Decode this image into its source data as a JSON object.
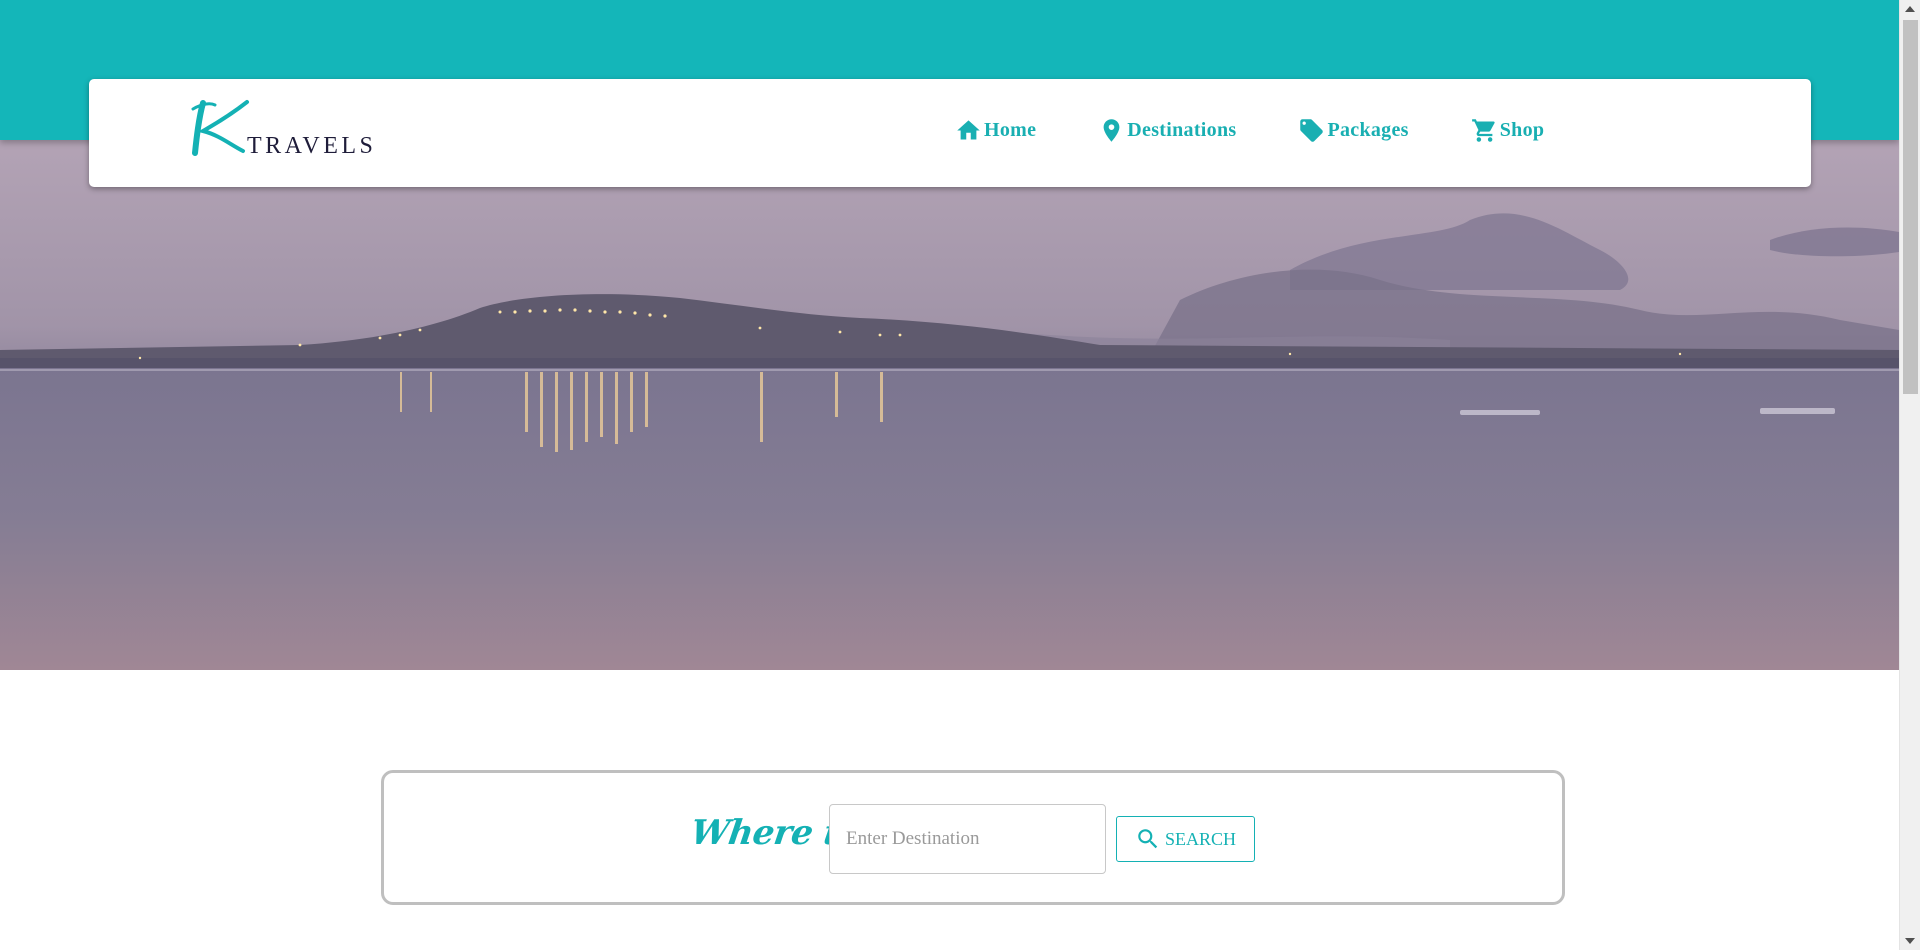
{
  "brand": {
    "mark": "K",
    "name": "TRAVELS"
  },
  "nav": {
    "items": [
      {
        "label": "Home",
        "icon": "home-icon"
      },
      {
        "label": "Destinations",
        "icon": "map-pin-icon"
      },
      {
        "label": "Packages",
        "icon": "tag-icon"
      },
      {
        "label": "Shop",
        "icon": "cart-icon"
      }
    ]
  },
  "hero": {
    "image": "lake-at-dusk-with-hillside-town-lights"
  },
  "search": {
    "label": "Where to?",
    "placeholder": "Enter Destination",
    "value": "",
    "button_label": "SEARCH",
    "button_icon": "search-icon"
  },
  "colors": {
    "accent": "#14b6b9",
    "brand_text": "#1f1d3a",
    "background": "#ffffff"
  }
}
